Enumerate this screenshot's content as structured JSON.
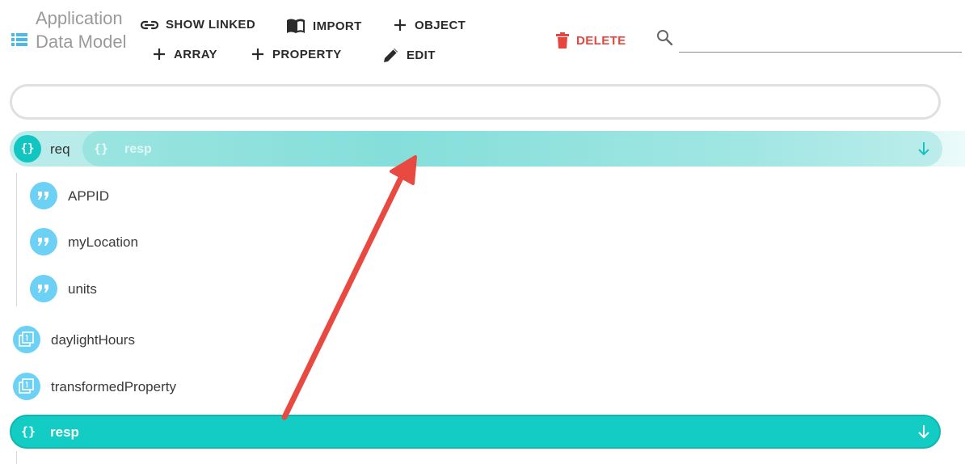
{
  "header": {
    "title": "Application Data Model"
  },
  "toolbar": {
    "show_linked": "SHOW LINKED",
    "import": "IMPORT",
    "object": "OBJECT",
    "array": "ARRAY",
    "property": "PROPERTY",
    "edit": "EDIT",
    "delete": "DELETE"
  },
  "search": {
    "value": "",
    "placeholder": ""
  },
  "filter": {
    "value": ""
  },
  "tree": {
    "req": {
      "label": "req",
      "icon": "{}",
      "children": [
        {
          "label": "APPID",
          "type": "string"
        },
        {
          "label": "myLocation",
          "type": "string"
        },
        {
          "label": "units",
          "type": "string"
        }
      ]
    },
    "dragging": {
      "label": "resp",
      "icon": "{}"
    },
    "root_props": [
      {
        "label": "daylightHours",
        "type": "array"
      },
      {
        "label": "transformedProperty",
        "type": "array"
      }
    ],
    "resp": {
      "label": "resp",
      "icon": "{}"
    }
  },
  "colors": {
    "accent": "#13cdc5",
    "accent_light": "#b9ebea",
    "string_icon": "#6dd0f5",
    "delete": "#e5463f",
    "annotation": "#e84a42"
  }
}
